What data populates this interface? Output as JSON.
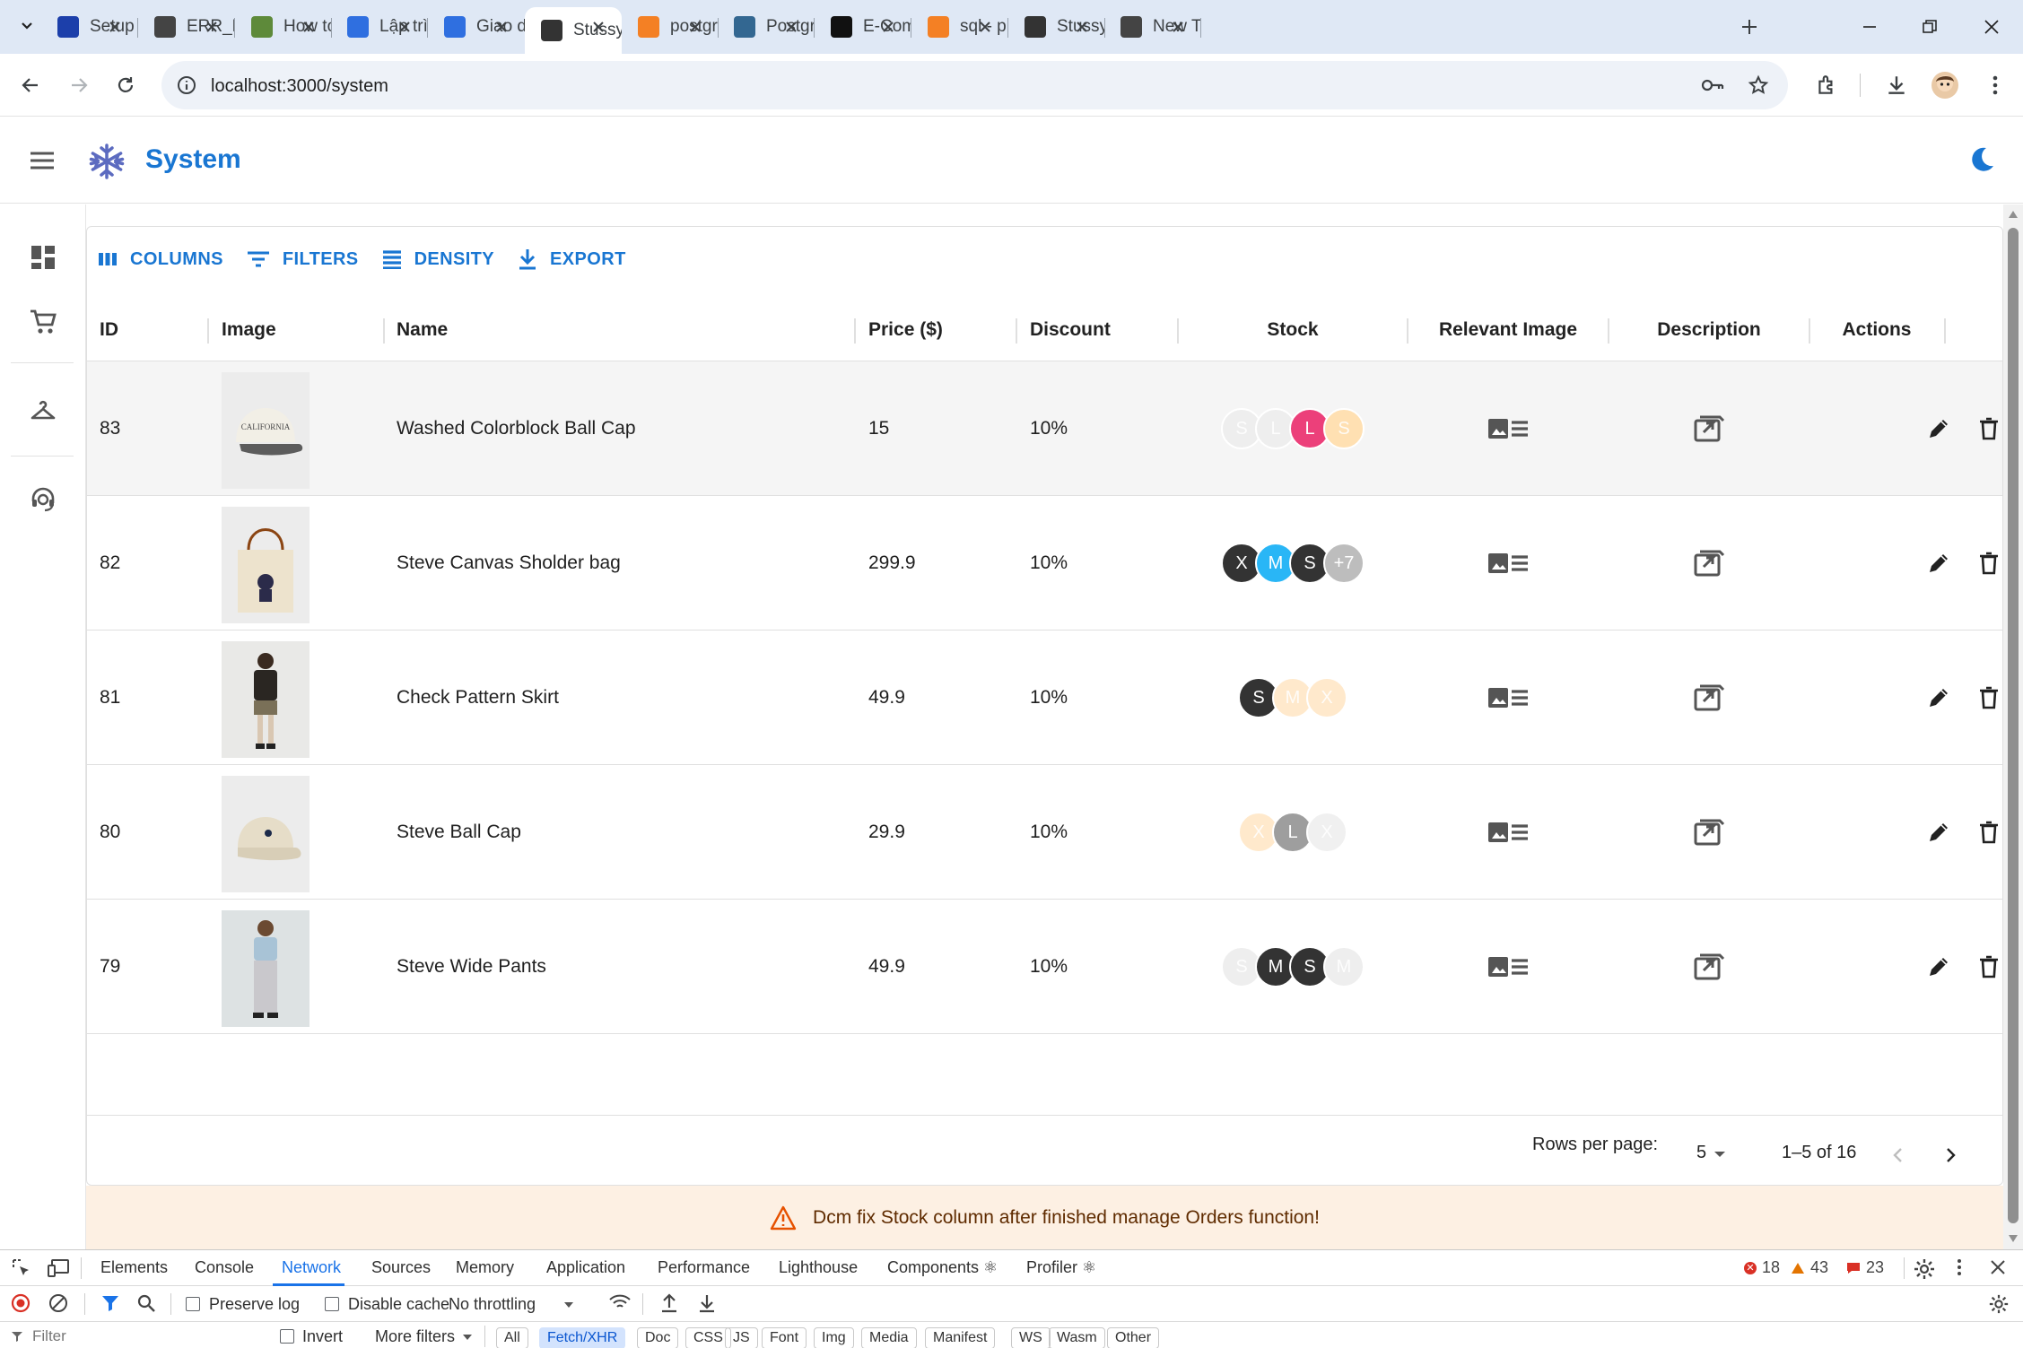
{
  "browser": {
    "tabs": [
      {
        "title": "Setup",
        "favicon": "notion-icon",
        "color": "#1c3faa",
        "active": false
      },
      {
        "title": "ERR_NGROK",
        "favicon": "globe-icon",
        "color": "#444444",
        "active": false
      },
      {
        "title": "How to",
        "favicon": "plugin-icon",
        "color": "#5e8a3a",
        "active": false
      },
      {
        "title": "Lập trình",
        "favicon": "diamond-icon",
        "color": "#2f6fe0",
        "active": false
      },
      {
        "title": "Giao diện",
        "favicon": "diamond-icon",
        "color": "#2f6fe0",
        "active": false
      },
      {
        "title": "Stussy",
        "favicon": "stussy-icon",
        "color": "#333333",
        "active": true
      },
      {
        "title": "postgres",
        "favicon": "stackoverflow-icon",
        "color": "#f48024",
        "active": false
      },
      {
        "title": "PostgreSQL",
        "favicon": "elephant-icon",
        "color": "#336791",
        "active": false
      },
      {
        "title": "E-Commerce",
        "favicon": "github-icon",
        "color": "#111111",
        "active": false
      },
      {
        "title": "sql - p",
        "favicon": "stackoverflow-icon",
        "color": "#f48024",
        "active": false
      },
      {
        "title": "Stussy",
        "favicon": "stussy-icon",
        "color": "#333333",
        "active": false
      },
      {
        "title": "New Tab",
        "favicon": "chrome-icon",
        "color": "#444444",
        "active": false
      }
    ],
    "url": "localhost:3000/system"
  },
  "app": {
    "title": "System",
    "brand_color": "#1976d2"
  },
  "grid": {
    "toolbar": {
      "columns": "COLUMNS",
      "filters": "FILTERS",
      "density": "DENSITY",
      "export": "EXPORT"
    },
    "headers": {
      "id": "ID",
      "image": "Image",
      "name": "Name",
      "price": "Price ($)",
      "discount": "Discount",
      "stock": "Stock",
      "relevant_image": "Relevant Image",
      "description": "Description",
      "actions": "Actions"
    },
    "rows": [
      {
        "id": "83",
        "name": "Washed Colorblock Ball Cap",
        "price": "15",
        "discount": "10%",
        "image": "cap-dark",
        "stock": [
          {
            "t": "S",
            "c": "#eeeeee"
          },
          {
            "t": "L",
            "c": "#eeeeee"
          },
          {
            "t": "L",
            "c": "#ec407a"
          },
          {
            "t": "S",
            "c": "#ffe0b2"
          }
        ]
      },
      {
        "id": "82",
        "name": "Steve Canvas Sholder bag",
        "price": "299.9",
        "discount": "10%",
        "image": "tote",
        "stock": [
          {
            "t": "X",
            "c": "#333333"
          },
          {
            "t": "M",
            "c": "#29b6f6"
          },
          {
            "t": "S",
            "c": "#333333"
          },
          {
            "t": "+7",
            "c": "#bdbdbd"
          }
        ]
      },
      {
        "id": "81",
        "name": "Check Pattern Skirt",
        "price": "49.9",
        "discount": "10%",
        "image": "model-dark",
        "stock": [
          {
            "t": "S",
            "c": "#333333"
          },
          {
            "t": "M",
            "c": "#ffe9cc"
          },
          {
            "t": "X",
            "c": "#ffe9cc"
          }
        ]
      },
      {
        "id": "80",
        "name": "Steve Ball Cap",
        "price": "29.9",
        "discount": "10%",
        "image": "cap-beige",
        "stock": [
          {
            "t": "X",
            "c": "#ffe9cc"
          },
          {
            "t": "L",
            "c": "#9e9e9e"
          },
          {
            "t": "X",
            "c": "#f0f0f0"
          }
        ]
      },
      {
        "id": "79",
        "name": "Steve Wide Pants",
        "price": "49.9",
        "discount": "10%",
        "image": "model-light",
        "stock": [
          {
            "t": "S",
            "c": "#eeeeee"
          },
          {
            "t": "M",
            "c": "#333333"
          },
          {
            "t": "S",
            "c": "#333333"
          },
          {
            "t": "M",
            "c": "#eeeeee"
          }
        ]
      }
    ],
    "footer": {
      "rows_per_page_label": "Rows per page:",
      "rows_per_page": "5",
      "range": "1–5 of 16"
    }
  },
  "banner": {
    "text": "Dcm fix Stock column after finished manage Orders function!",
    "icon": "warning-icon"
  },
  "devtools": {
    "tabs": [
      "Elements",
      "Console",
      "Network",
      "Sources",
      "Memory",
      "Application",
      "Performance",
      "Lighthouse",
      "Components ⚛",
      "Profiler ⚛"
    ],
    "active_tab": "Network",
    "errors": "18",
    "warnings": "43",
    "issues": "23",
    "preserve_log": "Preserve log",
    "disable_cache": "Disable cache",
    "throttling": "No throttling",
    "filter_placeholder": "Filter",
    "invert": "Invert",
    "more_filters": "More filters",
    "type_filters": [
      "All",
      "Fetch/XHR",
      "Doc",
      "CSS",
      "JS",
      "Font",
      "Img",
      "Media",
      "Manifest",
      "WS",
      "Wasm",
      "Other"
    ],
    "selected_type_filter": "Fetch/XHR"
  }
}
